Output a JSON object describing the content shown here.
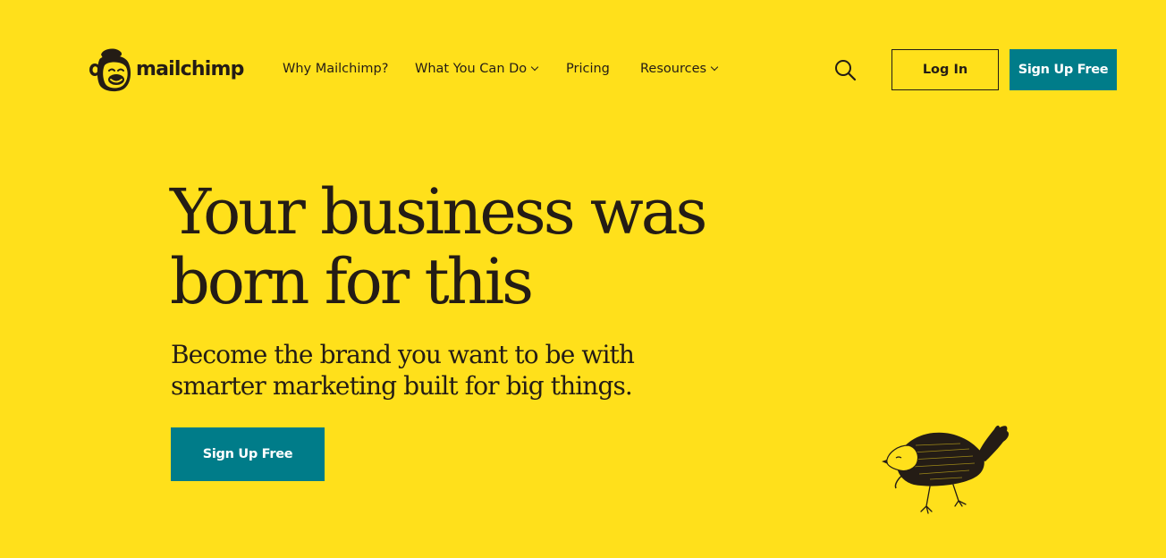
{
  "brand": {
    "name": "mailchimp",
    "icon": "freddie-monkey-logo"
  },
  "nav": {
    "items": [
      {
        "label": "Why Mailchimp?",
        "has_dropdown": false
      },
      {
        "label": "What You Can Do",
        "has_dropdown": true
      },
      {
        "label": "Pricing",
        "has_dropdown": false
      },
      {
        "label": "Resources",
        "has_dropdown": true
      }
    ]
  },
  "header": {
    "search_icon": "search-icon",
    "login_label": "Log In",
    "signup_label": "Sign Up Free"
  },
  "hero": {
    "title_line1": "Your business was",
    "title_line2": "born for this",
    "subtitle_line1": "Become the brand you want to be with",
    "subtitle_line2": "smarter marketing built for big things.",
    "cta_label": "Sign Up Free",
    "illustration": "bird-illustration"
  },
  "colors": {
    "background": "#FFE01B",
    "text": "#241C15",
    "accent": "#007C89",
    "button_text": "#FFFFFF"
  }
}
